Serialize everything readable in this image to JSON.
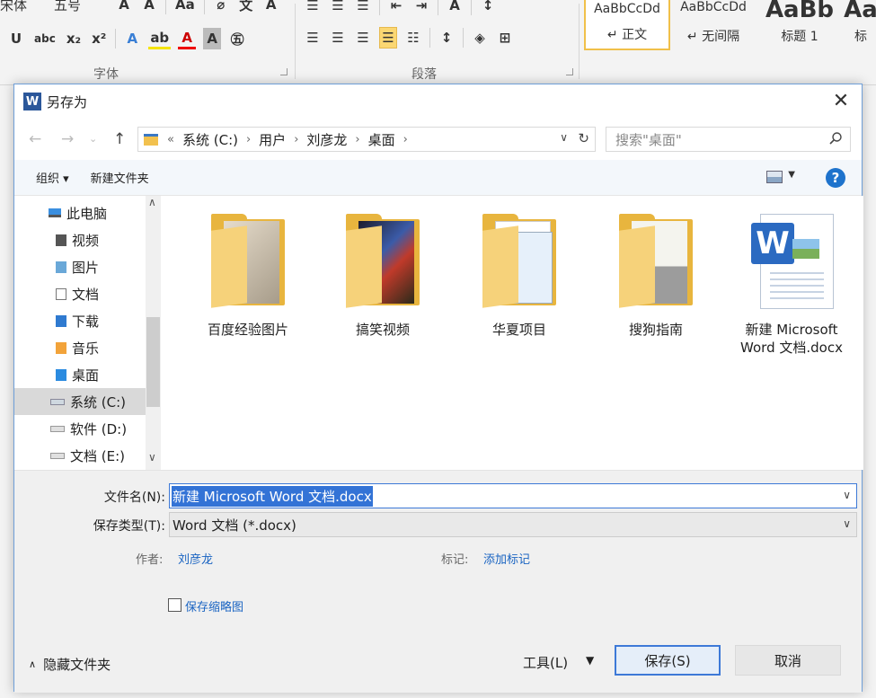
{
  "ribbon": {
    "font_group_label": "字体",
    "para_group_label": "段落",
    "font_name": "宋体",
    "font_size": "五号",
    "styles": [
      {
        "sample": "AaBbCcDd",
        "name": "↵ 正文",
        "selected": true
      },
      {
        "sample": "AaBbCcDd",
        "name": "↵ 无间隔",
        "selected": false
      },
      {
        "sample": "AaBb",
        "name": "标题 1",
        "selected": false
      },
      {
        "sample": "Aa",
        "name": "标",
        "selected": false
      }
    ]
  },
  "dialog": {
    "title": "另存为",
    "app_badge": "W",
    "close_glyph": "✕",
    "breadcrumb": [
      "系统 (C:)",
      "用户",
      "刘彦龙",
      "桌面"
    ],
    "breadcrumb_overflow": "«",
    "search_placeholder": "搜索\"桌面\"",
    "toolbar": {
      "organize": "组织 ▾",
      "new_folder": "新建文件夹",
      "help": "?"
    },
    "nav_items": [
      {
        "label": "此电脑",
        "icon": "pc-icon"
      },
      {
        "label": "视频",
        "icon": "video-icon"
      },
      {
        "label": "图片",
        "icon": "pictures-icon"
      },
      {
        "label": "文档",
        "icon": "documents-icon"
      },
      {
        "label": "下载",
        "icon": "downloads-icon"
      },
      {
        "label": "音乐",
        "icon": "music-icon"
      },
      {
        "label": "桌面",
        "icon": "desktop-icon"
      },
      {
        "label": "系统 (C:)",
        "icon": "drive-icon",
        "selected": true
      },
      {
        "label": "软件 (D:)",
        "icon": "drive-icon"
      },
      {
        "label": "文档 (E:)",
        "icon": "drive-icon"
      }
    ],
    "files": [
      {
        "name": "百度经验图片",
        "type": "folder"
      },
      {
        "name": "搞笑视频",
        "type": "folder"
      },
      {
        "name": "华夏项目",
        "type": "folder"
      },
      {
        "name": "搜狗指南",
        "type": "folder"
      },
      {
        "name": "新建 Microsoft Word 文档.docx",
        "type": "word"
      }
    ],
    "form": {
      "filename_label": "文件名(N):",
      "filename_value": "新建 Microsoft Word 文档.docx",
      "filetype_label": "保存类型(T):",
      "filetype_value": "Word 文档 (*.docx)",
      "author_label": "作者:",
      "author_value": "刘彦龙",
      "tags_label": "标记:",
      "tags_value": "添加标记",
      "thumbnail_label": "保存缩略图",
      "thumbnail_checked": false
    },
    "footer": {
      "hide_folders": "隐藏文件夹",
      "tools": "工具(L)",
      "save": "保存(S)",
      "cancel": "取消"
    }
  },
  "colors": {
    "accent_blue": "#3d79d7",
    "selection_blue": "#3373d6",
    "link_blue": "#1a64c2",
    "folder_yellow": "#e8b53e",
    "word_blue": "#2b579a"
  }
}
